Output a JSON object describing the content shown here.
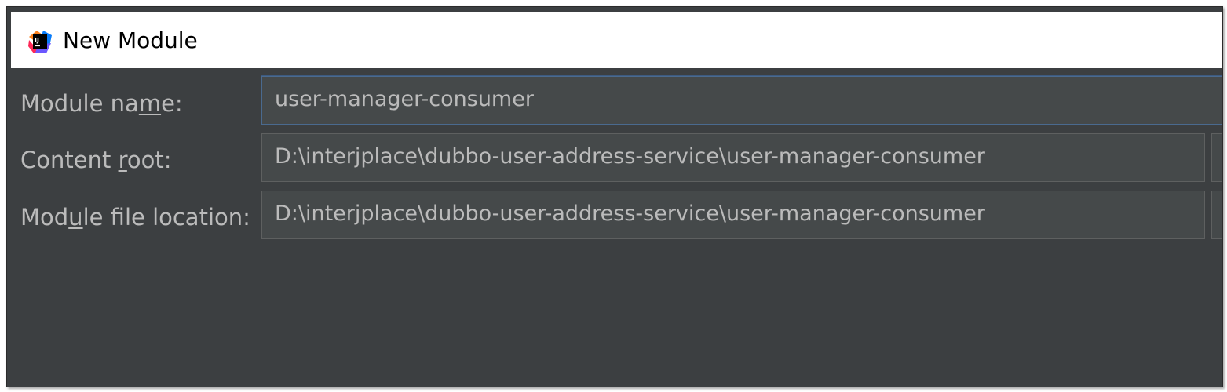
{
  "dialog": {
    "title": "New Module",
    "icon": "intellij-idea-icon"
  },
  "form": {
    "module_name": {
      "label_pre": "Module na",
      "label_mnemonic": "m",
      "label_post": "e:",
      "value": "user-manager-consumer"
    },
    "content_root": {
      "label_pre": "Content ",
      "label_mnemonic": "r",
      "label_post": "oot:",
      "value": "D:\\interjplace\\dubbo-user-address-service\\user-manager-consumer"
    },
    "module_file_location": {
      "label_pre": "Mod",
      "label_mnemonic": "u",
      "label_post": "le file location:",
      "value": "D:\\interjplace\\dubbo-user-address-service\\user-manager-consumer"
    }
  },
  "colors": {
    "dialog_bg": "#3c3f41",
    "field_bg": "#45494a",
    "field_border": "#5e6060",
    "focus_border": "#4a6a8f",
    "text": "#bbbbbb"
  }
}
